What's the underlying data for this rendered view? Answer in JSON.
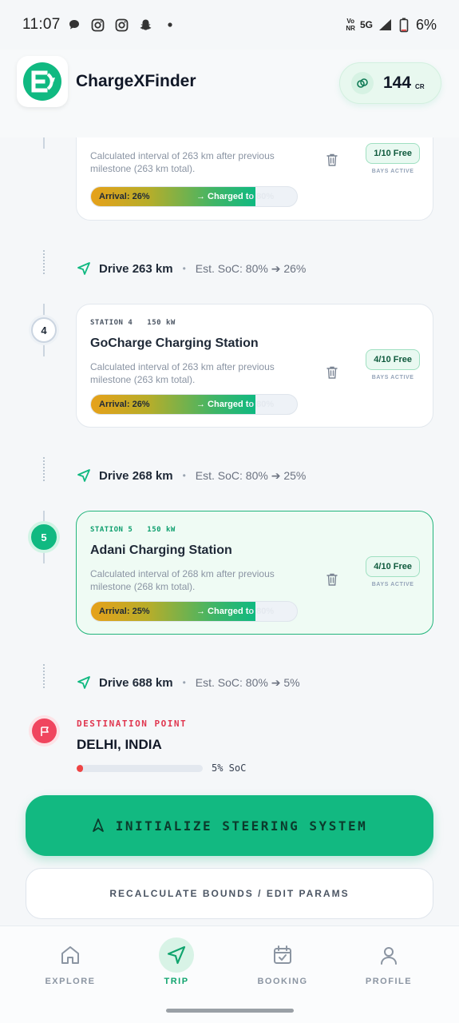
{
  "status_bar": {
    "time": "11:07",
    "network_top": "Vo",
    "network_bottom": "NR",
    "signal": "5G",
    "battery": "6%"
  },
  "header": {
    "app_name": "ChargeXFinder",
    "credits_value": "144",
    "credits_unit": "CR"
  },
  "stations": [
    {
      "number": "",
      "station_label": "",
      "power": "",
      "name": "",
      "description": "Calculated interval of 263 km after previous milestone (263 km total).",
      "bays": "1/10 Free",
      "bays_label": "BAYS ACTIVE",
      "arrival": "Arrival: 26%",
      "charged_visible": "→ Charged t",
      "charged_hidden": "o 80%",
      "arrival_level_pct": 26,
      "charge_level_pct": 80
    },
    {
      "number": "4",
      "station_label": "STATION 4",
      "power": "150 kW",
      "name": "GoCharge Charging Station",
      "description": "Calculated interval of 263 km after previous milestone (263 km total).",
      "bays": "4/10 Free",
      "bays_label": "BAYS ACTIVE",
      "arrival": "Arrival: 26%",
      "charged_visible": "→ Charged t",
      "charged_hidden": "o 80%",
      "arrival_level_pct": 26,
      "charge_level_pct": 80
    },
    {
      "number": "5",
      "station_label": "STATION 5",
      "power": "150 kW",
      "name": "Adani Charging Station",
      "description": "Calculated interval of 268 km after previous milestone (268 km total).",
      "bays": "4/10 Free",
      "bays_label": "BAYS ACTIVE",
      "arrival": "Arrival: 25%",
      "charged_visible": "→ Charged t",
      "charged_hidden": "o 80%",
      "arrival_level_pct": 25,
      "charge_level_pct": 80
    }
  ],
  "drives": [
    {
      "distance": "Drive 263 km",
      "soc": "Est. SoC: 80% ➔ 26%"
    },
    {
      "distance": "Drive 268 km",
      "soc": "Est. SoC: 80% ➔ 25%"
    },
    {
      "distance": "Drive 688 km",
      "soc": "Est. SoC: 80% ➔ 5%"
    }
  ],
  "destination": {
    "label": "DESTINATION POINT",
    "name": "DELHI, INDIA",
    "soc": "5% SoC",
    "soc_level_pct": 5
  },
  "actions": {
    "primary": "INITIALIZE STEERING SYSTEM",
    "secondary": "RECALCULATE BOUNDS / EDIT PARAMS"
  },
  "nav": {
    "items": [
      {
        "label": "EXPLORE",
        "icon": "home-icon"
      },
      {
        "label": "TRIP",
        "icon": "navigation-arrow-icon"
      },
      {
        "label": "BOOKING",
        "icon": "calendar-check-icon"
      },
      {
        "label": "PROFILE",
        "icon": "user-icon"
      }
    ],
    "active": "TRIP"
  },
  "colors": {
    "accent": "#10b981",
    "destination": "#f0455e",
    "background": "#f5f7f9"
  }
}
